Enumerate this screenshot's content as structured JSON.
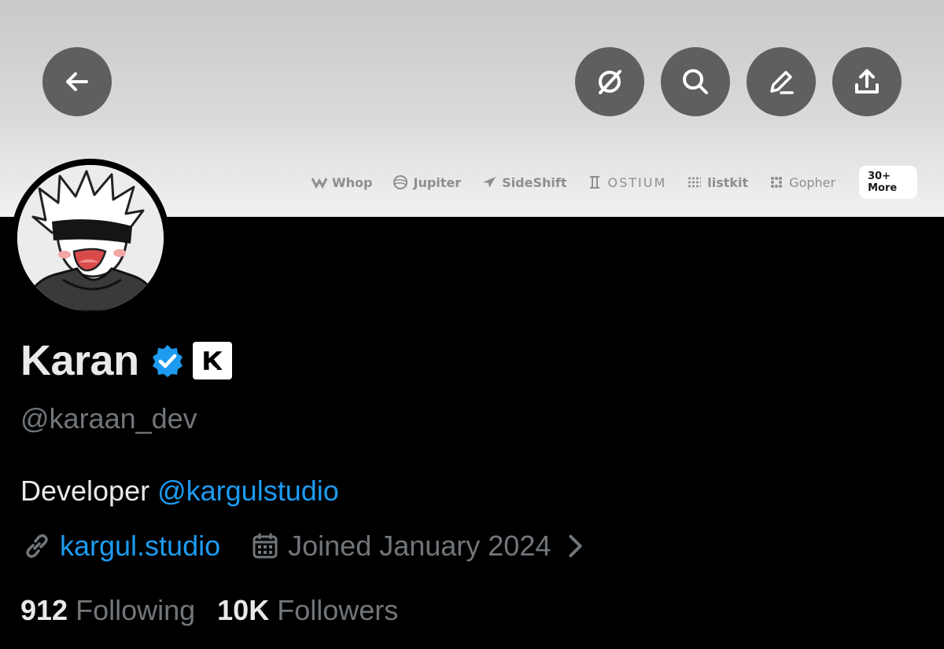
{
  "header": {
    "back_icon": "arrow-left-icon",
    "actions": [
      {
        "name": "grok-icon"
      },
      {
        "name": "search-icon"
      },
      {
        "name": "edit-icon"
      },
      {
        "name": "share-icon"
      }
    ]
  },
  "banner": {
    "sponsors": [
      "Whop",
      "Jupiter",
      "SideShift",
      "OSTIUM",
      "listkit",
      "Gopher"
    ],
    "more_label": "30+ More"
  },
  "profile": {
    "name": "Karan",
    "verified_icon": "verified-badge-icon",
    "affiliate_badge": "kargul-logo-icon",
    "handle": "@karaan_dev",
    "bio_text": "Developer ",
    "bio_mention": "@kargulstudio",
    "website": "kargul.studio",
    "joined": "Joined January 2024",
    "following_count": "912",
    "following_label": "Following",
    "followers_count": "10K",
    "followers_label": "Followers"
  },
  "colors": {
    "accent": "#1d9bf0",
    "muted_text": "#71767b",
    "background": "#000000"
  }
}
